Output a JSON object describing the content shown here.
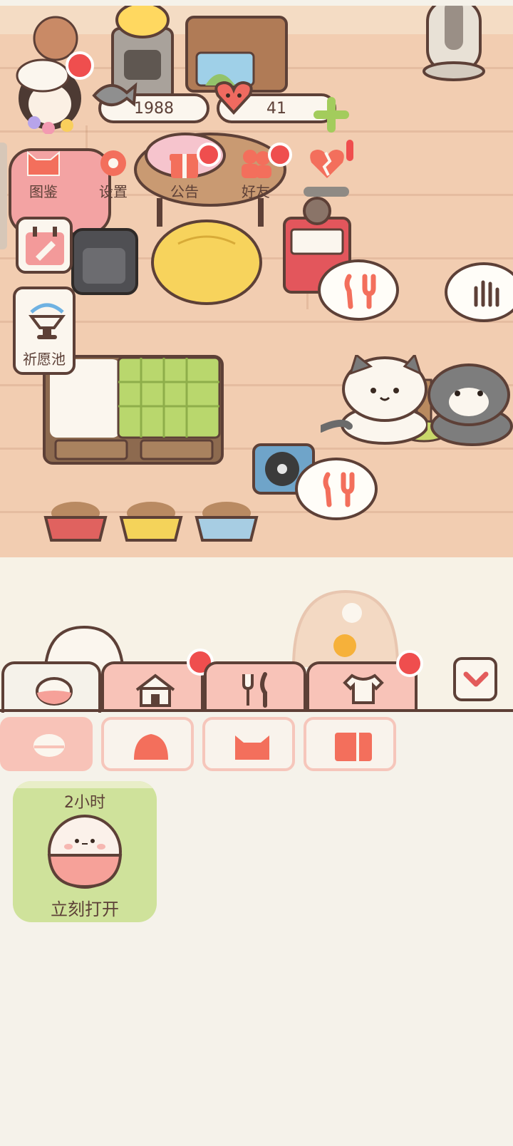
{
  "currency": {
    "fish": "1988",
    "hearts": "41"
  },
  "top_menu": [
    {
      "label": "图鉴"
    },
    {
      "label": "设置"
    },
    {
      "label": "公告"
    },
    {
      "label": "好友"
    }
  ],
  "wishing_pool": {
    "label": "祈愿池"
  },
  "inventory_card": {
    "time": "2小时",
    "action": "立刻打开"
  },
  "colors": {
    "accent": "#f36f5c",
    "outline": "#5d4037",
    "tab_pink": "#f8c3b8",
    "notify_red": "#ef4e4e"
  }
}
